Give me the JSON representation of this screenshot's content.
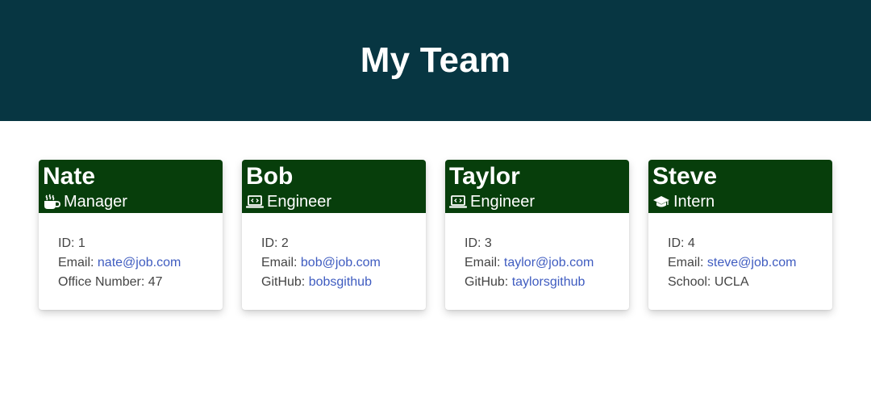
{
  "page": {
    "title": "My Team"
  },
  "colors": {
    "header_bg": "#073642",
    "card_header_bg": "#073e0b",
    "link": "#3f5cc0"
  },
  "team": [
    {
      "name": "Nate",
      "role": "Manager",
      "icon": "coffee-icon",
      "id_label": "ID: ",
      "id": "1",
      "email_label": "Email: ",
      "email": "nate@job.com",
      "extra_label": "Office Number: ",
      "extra_value": "47"
    },
    {
      "name": "Bob",
      "role": "Engineer",
      "icon": "laptop-code-icon",
      "id_label": "ID: ",
      "id": "2",
      "email_label": "Email: ",
      "email": "bob@job.com",
      "extra_label": "GitHub: ",
      "extra_value": "bobsgithub"
    },
    {
      "name": "Taylor",
      "role": "Engineer",
      "icon": "laptop-code-icon",
      "id_label": "ID: ",
      "id": "3",
      "email_label": "Email: ",
      "email": "taylor@job.com",
      "extra_label": "GitHub: ",
      "extra_value": "taylorsgithub"
    },
    {
      "name": "Steve",
      "role": "Intern",
      "icon": "graduation-cap-icon",
      "id_label": "ID: ",
      "id": "4",
      "email_label": "Email: ",
      "email": "steve@job.com",
      "extra_label": "School: ",
      "extra_value": "UCLA"
    }
  ]
}
